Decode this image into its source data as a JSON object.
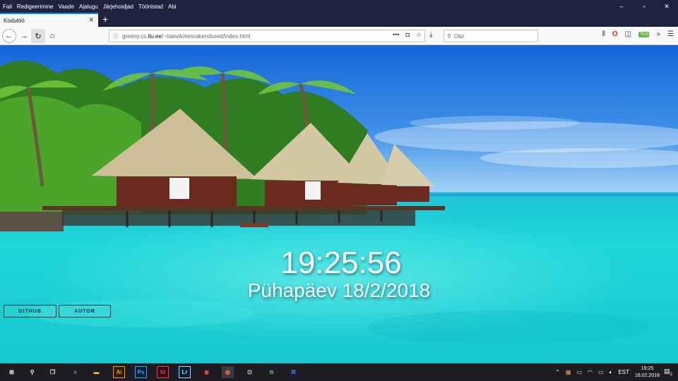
{
  "window": {
    "menu": [
      "Fail",
      "Redigeerimine",
      "Vaade",
      "Ajalugu",
      "Järjehoidjad",
      "Tööriistad",
      "Abi"
    ],
    "controls": {
      "minimize": "–",
      "maximize": "▫",
      "close": "✕"
    }
  },
  "tabs": [
    {
      "title": "Kodutöö",
      "close": "✕"
    }
  ],
  "new_tab_label": "+",
  "navbar": {
    "url_prefix": "greeny.cs.",
    "url_domain": "tlu.ee",
    "url_suffix": "/~ttaevik/eesrakendused/index.html",
    "page_actions": "•••",
    "search_placeholder": "Otsi",
    "tlu_badge": "TLÜ"
  },
  "page": {
    "time": "19:25:56",
    "date": "Pühapäev 18/2/2018",
    "github_label": "GITHUB",
    "author_label": "AUTOR"
  },
  "taskbar": {
    "apps": [
      {
        "name": "start",
        "glyph": "⊞",
        "color": "#ffffff",
        "bg": "none"
      },
      {
        "name": "search",
        "glyph": "⚲",
        "color": "#ffffff",
        "bg": "none"
      },
      {
        "name": "task-view",
        "glyph": "❐",
        "color": "#ffffff",
        "bg": "none"
      },
      {
        "name": "edge",
        "glyph": "e",
        "color": "#2d8fe6",
        "bg": "none"
      },
      {
        "name": "explorer",
        "glyph": "▬",
        "color": "#f2c94c",
        "bg": "none"
      },
      {
        "name": "illustrator",
        "glyph": "Ai",
        "color": "#ff9a00",
        "bg": "#2a1a04"
      },
      {
        "name": "photoshop",
        "glyph": "Ps",
        "color": "#31a8ff",
        "bg": "#001d34"
      },
      {
        "name": "indesign",
        "glyph": "Id",
        "color": "#ff3366",
        "bg": "#2d0213"
      },
      {
        "name": "lightroom",
        "glyph": "Lr",
        "color": "#add5ec",
        "bg": "#001e36"
      },
      {
        "name": "chrome",
        "glyph": "◉",
        "color": "#e74c3c",
        "bg": "none"
      },
      {
        "name": "firefox",
        "glyph": "◍",
        "color": "#ff7139",
        "bg": "none"
      },
      {
        "name": "network-app",
        "glyph": "⊡",
        "color": "#cfd8dc",
        "bg": "none"
      },
      {
        "name": "remote-app",
        "glyph": "⧉",
        "color": "#4caf50",
        "bg": "none"
      },
      {
        "name": "vscode",
        "glyph": "⌘",
        "color": "#2f80ed",
        "bg": "none"
      }
    ],
    "tray": {
      "language": "EST",
      "time": "19:25",
      "date": "18.02.2018",
      "notif_count": "2"
    }
  }
}
